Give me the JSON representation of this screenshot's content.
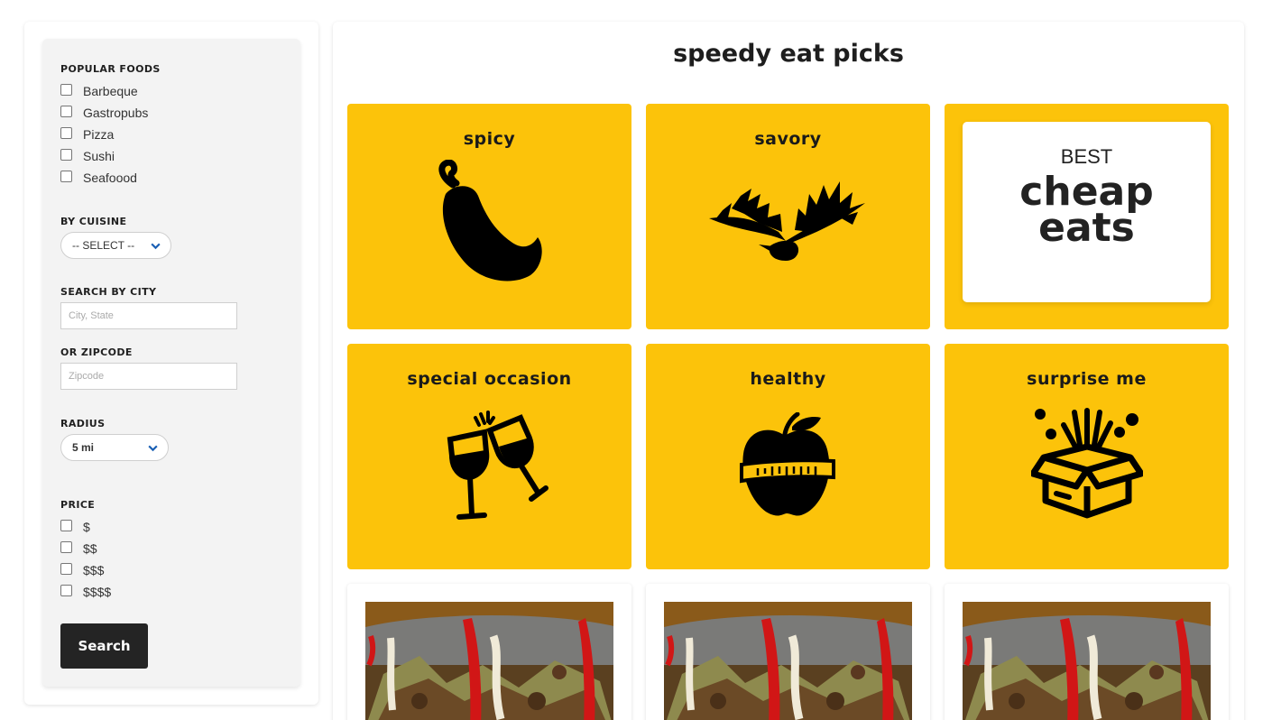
{
  "filters": {
    "popular_foods": {
      "heading": "POPULAR FOODS",
      "items": [
        "Barbeque",
        "Gastropubs",
        "Pizza",
        "Sushi",
        "Seafoood"
      ]
    },
    "cuisine": {
      "heading": "BY CUISINE",
      "selected": "-- SELECT --"
    },
    "city": {
      "heading": "SEARCH BY CITY",
      "placeholder": "City, State"
    },
    "zip": {
      "heading": "OR ZIPCODE",
      "placeholder": "Zipcode"
    },
    "radius": {
      "heading": "RADIUS",
      "selected": "5 mi"
    },
    "price": {
      "heading": "PRICE",
      "items": [
        "$",
        "$$",
        "$$$",
        "$$$$"
      ]
    },
    "search_label": "Search"
  },
  "main": {
    "title": "speedy eat picks",
    "tiles": {
      "spicy": "spicy",
      "savory": "savory",
      "cheap_best": "BEST",
      "cheap_line1": "cheap",
      "cheap_line2": "eats",
      "special": "special occasion",
      "healthy": "healthy",
      "surprise": "surprise me"
    }
  },
  "colors": {
    "tile_yellow": "#fcc30a",
    "button_dark": "#242424",
    "select_chevron": "#1a5fb4"
  }
}
